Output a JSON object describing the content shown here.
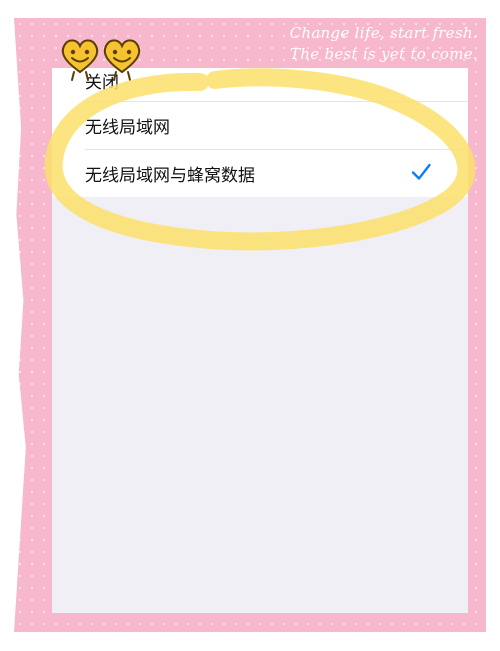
{
  "decor": {
    "slogan_line1": "Change life, start fresh.",
    "slogan_line2": "The best is yet to come.",
    "frame_color": "#f7b8cd",
    "highlight_color": "#fbe06a",
    "sticker_icon": "smiley-heart-icon"
  },
  "settings": {
    "options": [
      {
        "label": "关闭",
        "selected": false
      },
      {
        "label": "无线局域网",
        "selected": false
      },
      {
        "label": "无线局域网与蜂窝数据",
        "selected": true
      }
    ],
    "checkmark_color": "#0a7aff"
  }
}
